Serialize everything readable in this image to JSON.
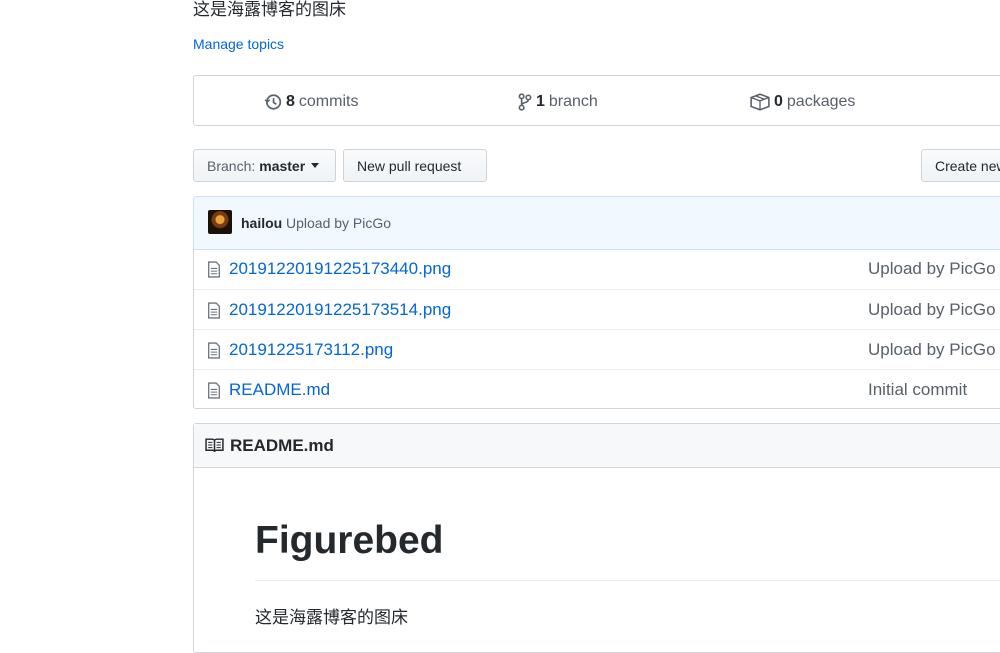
{
  "repo": {
    "description": "这是海露博客的图床",
    "manage_topics": "Manage topics"
  },
  "summary": {
    "commits": {
      "count": "8",
      "label": "commits",
      "icon": "history-icon"
    },
    "branches": {
      "count": "1",
      "label": "branch",
      "icon": "git-branch-icon"
    },
    "packages": {
      "count": "0",
      "label": "packages",
      "icon": "package-icon"
    }
  },
  "toolbar": {
    "branch_prefix": "Branch:",
    "branch_name": "master",
    "new_pull_request": "New pull request",
    "create_new": "Create new file"
  },
  "commit_tease": {
    "author": "hailou",
    "message": "Upload by PicGo"
  },
  "files": [
    {
      "name": "20191220191225173440.png",
      "message": "Upload by PicGo"
    },
    {
      "name": "20191220191225173514.png",
      "message": "Upload by PicGo"
    },
    {
      "name": "20191225173112.png",
      "message": "Upload by PicGo"
    },
    {
      "name": "README.md",
      "message": "Initial commit"
    }
  ],
  "readme": {
    "title": "README.md",
    "heading": "Figurebed",
    "paragraph": "这是海露博客的图床"
  },
  "colors": {
    "link": "#0366d6",
    "muted": "#586069",
    "text": "#24292e",
    "tease_bg": "#f1f8ff"
  }
}
